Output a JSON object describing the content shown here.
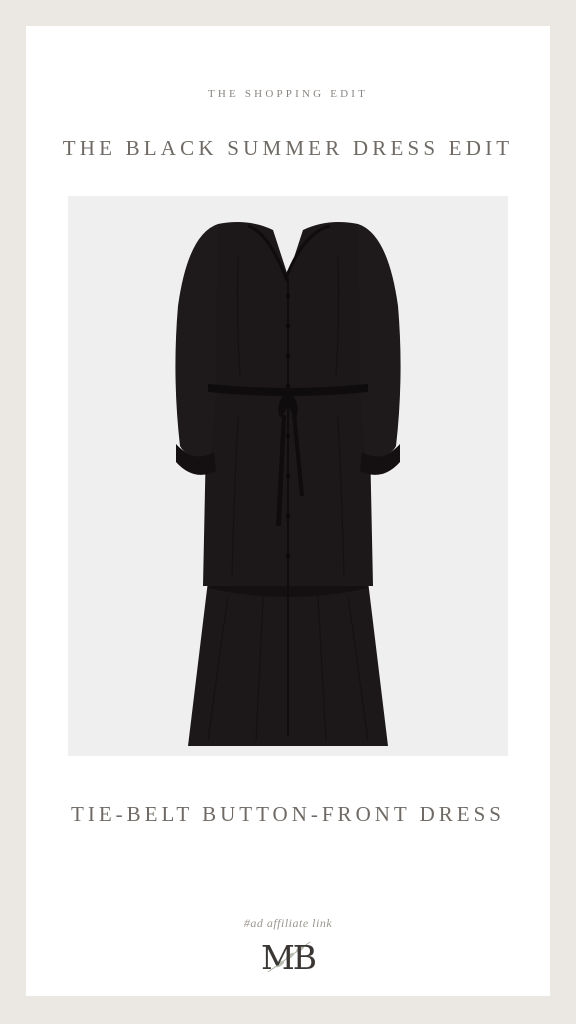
{
  "header": {
    "eyebrow": "THE SHOPPING EDIT",
    "title": "THE BLACK SUMMER DRESS EDIT"
  },
  "product": {
    "name": "TIE-BELT BUTTON-FRONT DRESS",
    "image_icon": "black-dress-image"
  },
  "footer": {
    "affiliate_note": "#ad affiliate link",
    "logo_text": "MB"
  },
  "colors": {
    "background": "#ebe7e3",
    "card": "#ffffff",
    "text": "#6f6a65",
    "dress": "#1c1719"
  }
}
